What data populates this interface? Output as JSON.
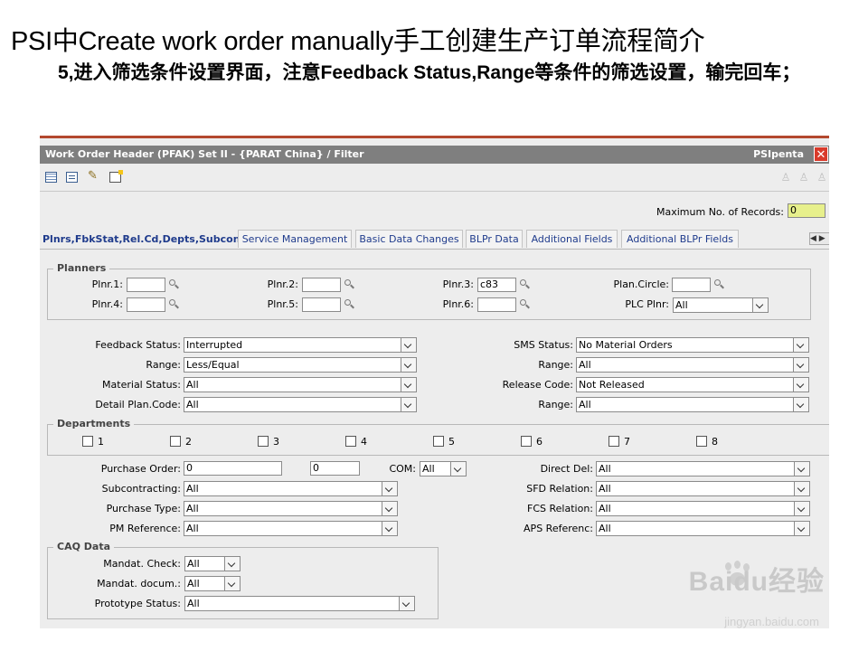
{
  "slide": {
    "title": "PSI中Create work order manually手工创建生产订单流程简介",
    "subtitle": "5,进入筛选条件设置界面，注意Feedback Status,Range等条件的筛选设置，输完回车；"
  },
  "window": {
    "title": "Work Order Header  (PFAK)  Set II - {PARAT China} / Filter",
    "brand": "PSIpenta",
    "close": "✕"
  },
  "toolbar": {
    "icons": [
      "table-icon",
      "form-icon",
      "wand-icon",
      "new-record-icon"
    ],
    "right_icons": [
      "person-icon",
      "people-icon",
      "group-icon"
    ]
  },
  "max_records": {
    "label": "Maximum No. of Records:",
    "value": "0"
  },
  "tabs": [
    {
      "label": "Plnrs,FbkStat,Rel.Cd,Depts,Subcontr",
      "active": true
    },
    {
      "label": "Service Management"
    },
    {
      "label": "Basic Data Changes"
    },
    {
      "label": "BLPr Data"
    },
    {
      "label": "Additional Fields"
    },
    {
      "label": "Additional BLPr Fields"
    }
  ],
  "tab_scroll": "◀ ▶",
  "planners": {
    "title": "Planners",
    "fields": [
      {
        "label": "Plnr.1:",
        "value": ""
      },
      {
        "label": "Plnr.2:",
        "value": ""
      },
      {
        "label": "Plnr.3:",
        "value": "c83"
      },
      {
        "label": "Plan.Circle:",
        "value": ""
      },
      {
        "label": "Plnr.4:",
        "value": ""
      },
      {
        "label": "Plnr.5:",
        "value": ""
      },
      {
        "label": "Plnr.6:",
        "value": ""
      }
    ],
    "plc": {
      "label": "PLC Plnr:",
      "value": "All"
    }
  },
  "status_left": [
    {
      "label": "Feedback Status:",
      "value": "Interrupted"
    },
    {
      "label": "Range:",
      "value": "Less/Equal"
    },
    {
      "label": "Material Status:",
      "value": "All"
    },
    {
      "label": "Detail Plan.Code:",
      "value": "All"
    }
  ],
  "status_right": [
    {
      "label": "SMS Status:",
      "value": "No Material Orders"
    },
    {
      "label": "Range:",
      "value": "All"
    },
    {
      "label": "Release Code:",
      "value": "Not Released"
    },
    {
      "label": "Range:",
      "value": "All"
    }
  ],
  "departments": {
    "title": "Departments",
    "items": [
      "1",
      "2",
      "3",
      "4",
      "5",
      "6",
      "7",
      "8"
    ]
  },
  "purchase": {
    "order_label": "Purchase Order:",
    "order_from": "0",
    "order_to": "0",
    "com_label": "COM:",
    "com_value": "All",
    "left": [
      {
        "label": "Subcontracting:",
        "value": "All"
      },
      {
        "label": "Purchase Type:",
        "value": "All"
      },
      {
        "label": "PM Reference:",
        "value": "All"
      }
    ],
    "right": [
      {
        "label": "Direct Del:",
        "value": "All"
      },
      {
        "label": "SFD Relation:",
        "value": "All"
      },
      {
        "label": "FCS Relation:",
        "value": "All"
      },
      {
        "label": "APS Referenc:",
        "value": "All"
      }
    ]
  },
  "caq": {
    "title": "CAQ Data",
    "fields": [
      {
        "label": "Mandat. Check:",
        "value": "All"
      },
      {
        "label": "Mandat. docum.:",
        "value": "All"
      },
      {
        "label": "Prototype Status:",
        "value": "All"
      }
    ]
  },
  "watermark": {
    "logo": "Baidu经验",
    "url": "jingyan.baidu.com"
  }
}
